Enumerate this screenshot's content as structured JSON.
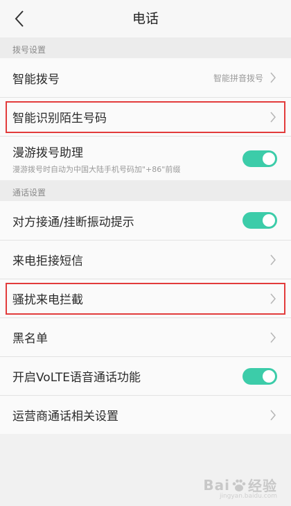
{
  "header": {
    "title": "电话"
  },
  "sections": [
    {
      "title": "拨号设置",
      "rows": [
        {
          "label": "智能拨号",
          "value": "智能拼音拨号",
          "control": "chevron"
        },
        {
          "label": "智能识别陌生号码",
          "control": "chevron",
          "highlighted": true
        },
        {
          "label": "漫游拨号助理",
          "sub": "漫游拨号时自动为中国大陆手机号码加\"+86\"前缀",
          "control": "toggle",
          "on": true
        }
      ]
    },
    {
      "title": "通话设置",
      "rows": [
        {
          "label": "对方接通/挂断振动提示",
          "control": "toggle",
          "on": true
        },
        {
          "label": "来电拒接短信",
          "control": "chevron"
        },
        {
          "label": "骚扰来电拦截",
          "control": "chevron",
          "highlighted": true
        },
        {
          "label": "黑名单",
          "control": "chevron"
        },
        {
          "label": "开启VoLTE语音通话功能",
          "control": "toggle",
          "on": true
        },
        {
          "label": "运营商通话相关设置",
          "control": "chevron"
        }
      ]
    }
  ],
  "watermark": {
    "text_left": "Bai",
    "text_right": "经验",
    "site": "jingyan.baidu.com"
  },
  "colors": {
    "toggle_on": "#3ccca9",
    "highlight_border": "#e23b3b"
  }
}
